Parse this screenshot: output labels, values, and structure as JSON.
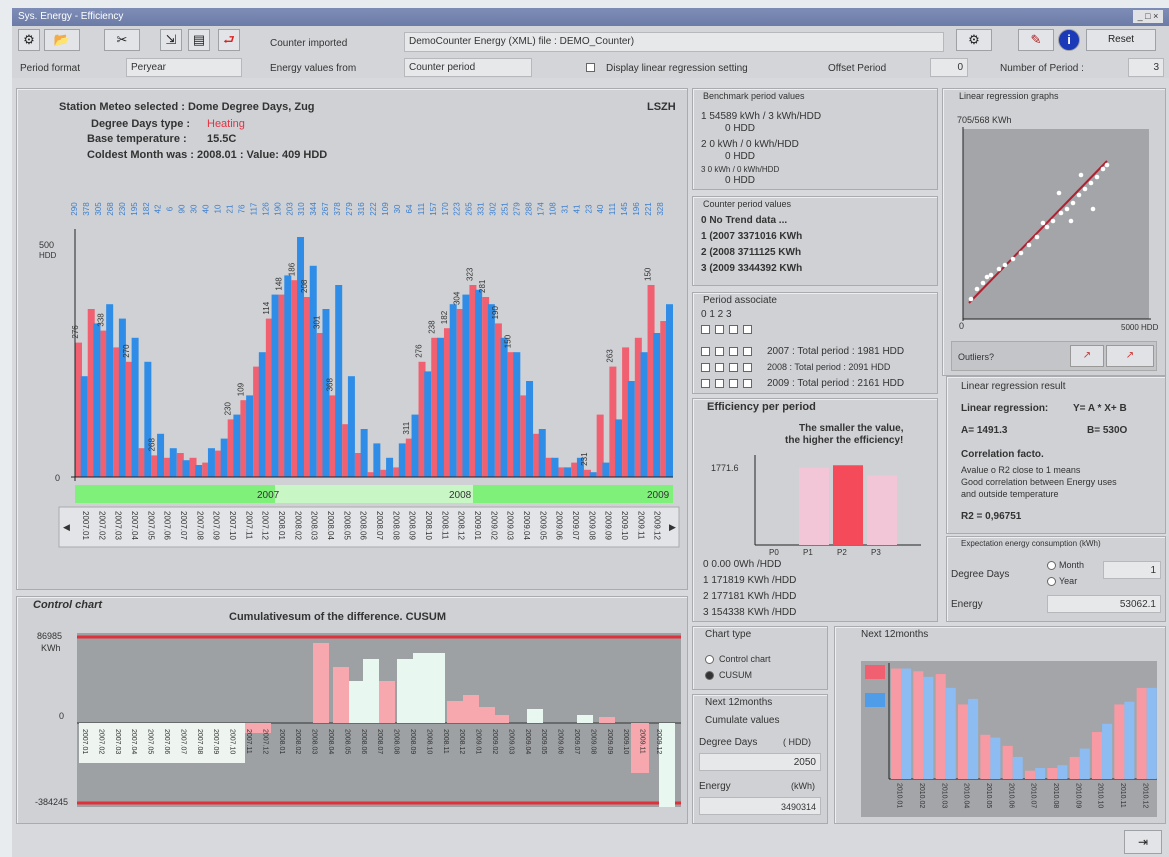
{
  "window": {
    "title": "Sys. Energy - Efficiency"
  },
  "toolbar": {
    "counter_imported_label": "Counter imported",
    "counter_imported_value": "DemoCounter Energy (XML) file : DEMO_Counter)",
    "reset_label": "Reset",
    "period_format_label": "Period format",
    "period_format_value": "Peryear",
    "energy_values_label": "Energy values from",
    "energy_values_value": "Counter period",
    "display_regression_label": "Display linear regression setting",
    "offset_period_label": "Offset Period",
    "offset_period_value": "0",
    "number_period_label": "Number of Period :",
    "number_period_value": "3"
  },
  "station": {
    "line1": "Station Meteo selected : Dome Degree Days, Zug",
    "code": "LSZH",
    "type_label": "Degree Days type :",
    "type_value": "Heating",
    "base_label": "Base temperature :",
    "base_value": "15.5C",
    "coldest": "Coldest Month was : 2008.01 : Value: 409 HDD"
  },
  "colors": {
    "red": "#f06070",
    "blue": "#2f8de8",
    "green": "#7ff07a",
    "pink_light": "#f7a8ae",
    "mint": "#e8f7ef",
    "grey_plot": "#9ea1a4",
    "red_line": "#e0303a"
  },
  "main_chart": {
    "y_top_label": "500",
    "y_unit": "HDD",
    "y_zero": "0",
    "year_2007": "2007",
    "year_2008": "2008",
    "year_2009": "2009",
    "top_values": [
      "290",
      "378",
      "305",
      "268",
      "230",
      "195",
      "182",
      "42",
      "6",
      "90",
      "30",
      "40",
      "10",
      "21",
      "76",
      "117",
      "126",
      "190",
      "203",
      "310",
      "344",
      "267",
      "378",
      "279",
      "316",
      "222",
      "109",
      "30",
      "64",
      "111",
      "157",
      "170",
      "223",
      "265",
      "331",
      "302",
      "251",
      "279",
      "288",
      "174",
      "108",
      "31",
      "41",
      "23",
      "40",
      "111",
      "145",
      "196",
      "221",
      "328"
    ],
    "red": [
      280,
      350,
      305,
      270,
      240,
      60,
      45,
      40,
      50,
      40,
      30,
      55,
      120,
      160,
      230,
      330,
      380,
      410,
      375,
      300,
      170,
      110,
      50,
      10,
      15,
      20,
      80,
      240,
      290,
      310,
      350,
      400,
      375,
      320,
      260,
      170,
      90,
      40,
      20,
      30,
      15,
      130,
      230,
      270,
      290,
      400,
      325
    ],
    "blue": [
      210,
      320,
      360,
      330,
      290,
      240,
      90,
      60,
      35,
      25,
      60,
      80,
      130,
      170,
      260,
      380,
      420,
      500,
      440,
      350,
      400,
      210,
      100,
      70,
      40,
      70,
      130,
      220,
      290,
      360,
      380,
      390,
      360,
      290,
      260,
      200,
      100,
      40,
      20,
      40,
      10,
      30,
      120,
      200,
      260,
      300,
      360
    ],
    "red_labels": [
      "276",
      "338",
      "270",
      "268",
      "230",
      "109",
      "114",
      "148",
      "186",
      "208",
      "301",
      "368",
      "311",
      "276",
      "238",
      "182",
      "304",
      "323",
      "281",
      "190",
      "150",
      "231",
      "263",
      "150"
    ],
    "x_labels": [
      "2007.01",
      "2007.02",
      "2007.03",
      "2007.04",
      "2007.05",
      "2007.06",
      "2007.07",
      "2007.08",
      "2007.09",
      "2007.10",
      "2007.11",
      "2007.12",
      "2008.01",
      "2008.02",
      "2008.03",
      "2008.04",
      "2008.05",
      "2008.06",
      "2008.07",
      "2008.08",
      "2008.09",
      "2008.10",
      "2008.11",
      "2008.12",
      "2009.01",
      "2009.02",
      "2009.03",
      "2009.04",
      "2009.05",
      "2009.06",
      "2009.07",
      "2009.08",
      "2009.09",
      "2009.10",
      "2009.11",
      "2009.12"
    ]
  },
  "benchmark": {
    "title": "Benchmark period values",
    "r1a": "1  54589 kWh / 3 kWh/HDD",
    "r1b": "0 HDD",
    "r2a": "2  0 kWh / 0 kWh/HDD",
    "r2b": "0 HDD",
    "r3a": "3  0 kWh / 0 kWh/HDD",
    "r3b": "0 HDD"
  },
  "counter_values": {
    "title": "Counter period values",
    "rows": [
      "0  No Trend data ...",
      "1  (2007 3371016 KWh",
      "2  (2008 3711125 KWh",
      "3  (2009 3344392 KWh"
    ]
  },
  "period_associate": {
    "title": "Period associate",
    "head": "0  1  2  3",
    "rows": [
      "2007 :  Total period :  1981 HDD",
      "2008 :  Total period :  2091 HDD",
      "2009 :  Total period :  2161 HDD"
    ]
  },
  "efficiency": {
    "title": "Efficiency per period",
    "note1": "The smaller the value,",
    "note2": "the higher the efficiency!",
    "y_label": "1771.6",
    "x_labels": [
      "P0",
      "P1",
      "P2",
      "P3"
    ],
    "bar_values": [
      0,
      171819,
      177181,
      154338
    ],
    "rows": [
      "0  0.00 0Wh /HDD",
      "1  171819 KWh /HDD",
      "2  177181 KWh /HDD",
      "3  154338 KWh /HDD"
    ]
  },
  "regression_graph": {
    "title": "Linear regression graphs",
    "y_label": "705/568 KWh",
    "x_zero": "0",
    "x_max": "5000 HDD",
    "outliers_label": "Outliers?"
  },
  "regression_result": {
    "title": "Linear regression result",
    "label": "Linear regression:",
    "formula": "Y= A * X+ B",
    "a_value": "A=  1491.3",
    "b_value": "B=  530O",
    "correlation_title": "Correlation facto.",
    "desc1": "Avalue o R2 close to 1 means",
    "desc2": "Good correlation between Energy uses",
    "desc3": "and outside temperature",
    "r2": "R2 = 0,96751"
  },
  "expectation": {
    "title": "Expectation energy consumption (kWh)",
    "degree_days_label": "Degree Days",
    "month_label": "Month",
    "year_label": "Year",
    "degree_value": "1",
    "energy_label": "Energy",
    "energy_value": "53062.1"
  },
  "control_chart": {
    "title": "Control chart",
    "chart_title": "Cumulativesum of the difference. CUSUM",
    "top_value": "86985",
    "unit": "KWh",
    "zero": "0",
    "bottom_value": "-384245"
  },
  "chart_type": {
    "title": "Chart type",
    "control": "Control chart",
    "cusum": "CUSUM"
  },
  "next12": {
    "title": "Next 12months",
    "cumul": "Cumulate values",
    "degree_label": "Degree Days",
    "degree_unit": "( HDD)",
    "degree_value": "2050",
    "energy_label": "Energy",
    "energy_unit": "(kWh)",
    "energy_value": "3490314"
  },
  "next12_chart": {
    "title": "Next 12months",
    "red": [
      400,
      390,
      380,
      270,
      160,
      120,
      30,
      40,
      80,
      170,
      270,
      330
    ],
    "blue": [
      400,
      370,
      330,
      290,
      150,
      80,
      40,
      50,
      110,
      200,
      280,
      330
    ],
    "x_labels": [
      "2010.01",
      "2010.02",
      "2010.03",
      "2010.04",
      "2010.05",
      "2010.06",
      "2010.07",
      "2010.08",
      "2010.09",
      "2010.10",
      "2010.11",
      "2010.12"
    ]
  }
}
